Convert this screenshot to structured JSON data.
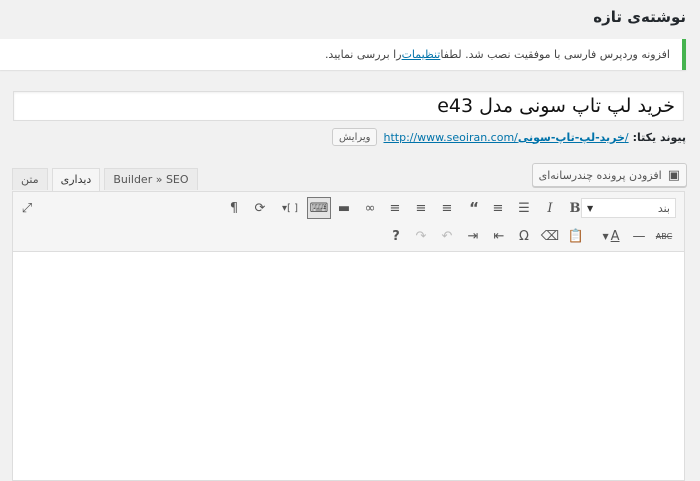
{
  "page": {
    "title": "نوشته‌ی تازه"
  },
  "notice": {
    "text_before": "افزونه وردپرس فارسی با موفقیت نصب شد. لطفا ",
    "link": "تنظیمات",
    "text_after": " را بررسی نمایید."
  },
  "post": {
    "title": "خرید لپ تاپ سونی مدل e43"
  },
  "permalink": {
    "label": "پیوند یکتا:",
    "base": "http://www.seoiran.com/",
    "slug": "خرید-لپ-تاپ-سونی",
    "trail": "/",
    "edit_label": "ویرایش"
  },
  "media": {
    "label": "افزودن پرونده چندرسانه‌ای"
  },
  "tabs": [
    {
      "label": "متن"
    },
    {
      "label": "دیداری"
    },
    {
      "label": "Builder » SEO"
    }
  ],
  "toolbar": {
    "format_select": "بند",
    "icons_row1": [
      "bold-icon",
      "italic-icon",
      "bulleted-list-icon",
      "numbered-list-icon",
      "blockquote-icon",
      "align-left-icon",
      "align-center-icon",
      "align-right-icon",
      "link-icon",
      "read-more-icon",
      "toolbar-toggle-icon",
      "insert-shortcode-icon",
      "refresh-icon",
      "paragraph-icon",
      "fullscreen-icon"
    ],
    "icons_row2": [
      "strikethrough-icon",
      "horizontal-line-icon",
      "text-color-icon",
      "paste-text-icon",
      "clear-formatting-icon",
      "special-character-icon",
      "outdent-icon",
      "indent-icon",
      "undo-icon",
      "redo-icon",
      "help-icon"
    ]
  },
  "colors": {
    "accent": "#0073aa",
    "notice_border": "#46b450"
  }
}
